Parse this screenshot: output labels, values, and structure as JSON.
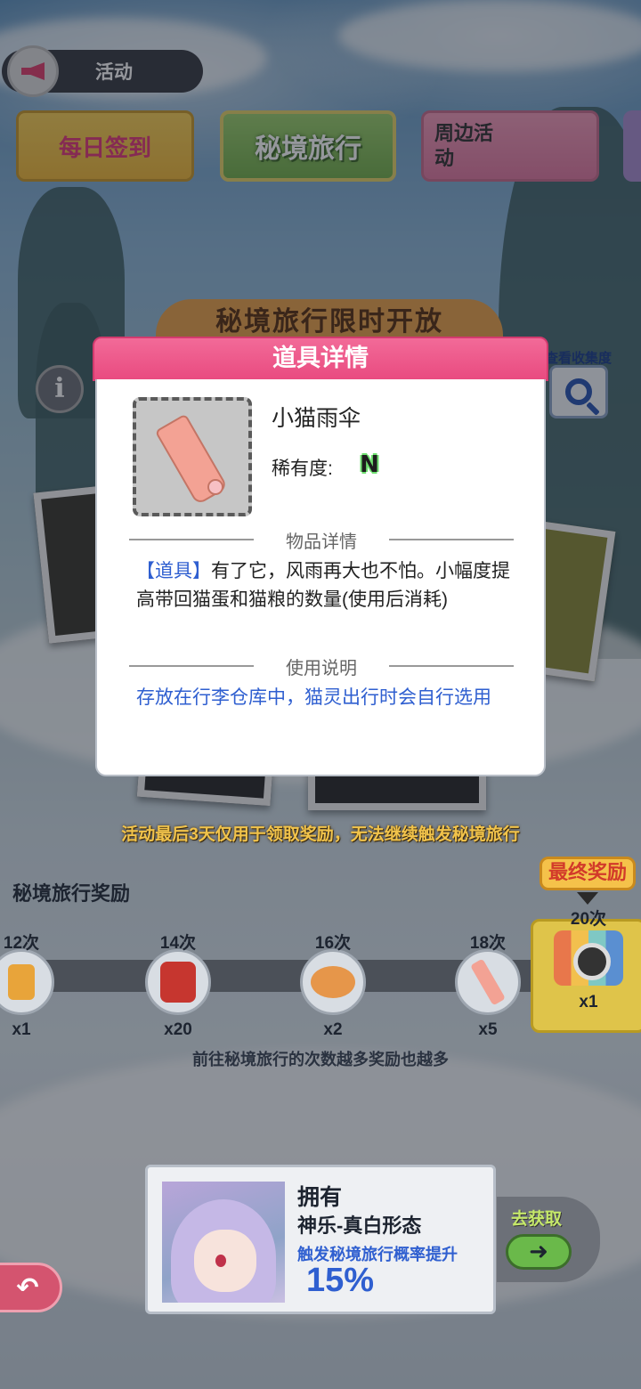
{
  "top_bar": {
    "activity_label": "活动"
  },
  "banners": {
    "daily_checkin": "每日签到",
    "secret_travel": "秘境旅行",
    "merch_event": "周边活动"
  },
  "event": {
    "title": "秘境旅行限时开放",
    "collection_label": "查看收集度",
    "notice": "活动最后3天仅用于领取奖励，无法继续触发秘境旅行"
  },
  "rewards": {
    "title": "秘境旅行奖励",
    "final_badge": "最终奖励",
    "milestones": [
      {
        "count": "12次",
        "qty": "x1"
      },
      {
        "count": "14次",
        "qty": "x20"
      },
      {
        "count": "16次",
        "qty": "x2"
      },
      {
        "count": "18次",
        "qty": "x5"
      }
    ],
    "final": {
      "count": "20次",
      "qty": "x1"
    },
    "hint": "前往秘境旅行的次数越多奖励也越多"
  },
  "bonus": {
    "own_label": "拥有",
    "character": "神乐-真白形态",
    "boost_text": "触发秘境旅行概率提升",
    "boost_value": "15%",
    "acquire_label": "去获取"
  },
  "popup": {
    "header": "道具详情",
    "item_name": "小猫雨伞",
    "rarity_label": "稀有度:",
    "rarity_value": "N",
    "detail_title": "物品详情",
    "detail_tag": "【道具】",
    "detail_text": "有了它，风雨再大也不怕。小幅度提高带回猫蛋和猫粮的数量(使用后消耗)",
    "usage_title": "使用说明",
    "usage_text": "存放在行李仓库中，猫灵出行时会自行选用"
  },
  "icons": {
    "megaphone": "megaphone-icon",
    "info": "info-icon",
    "search": "search-icon",
    "back": "back-arrow-icon",
    "go": "right-arrow-icon"
  },
  "colors": {
    "popup_header": "#e94b80",
    "accent_blue": "#2f5fd0",
    "notice_yellow": "#f1c34b",
    "rarity_green": "#6fe070"
  }
}
